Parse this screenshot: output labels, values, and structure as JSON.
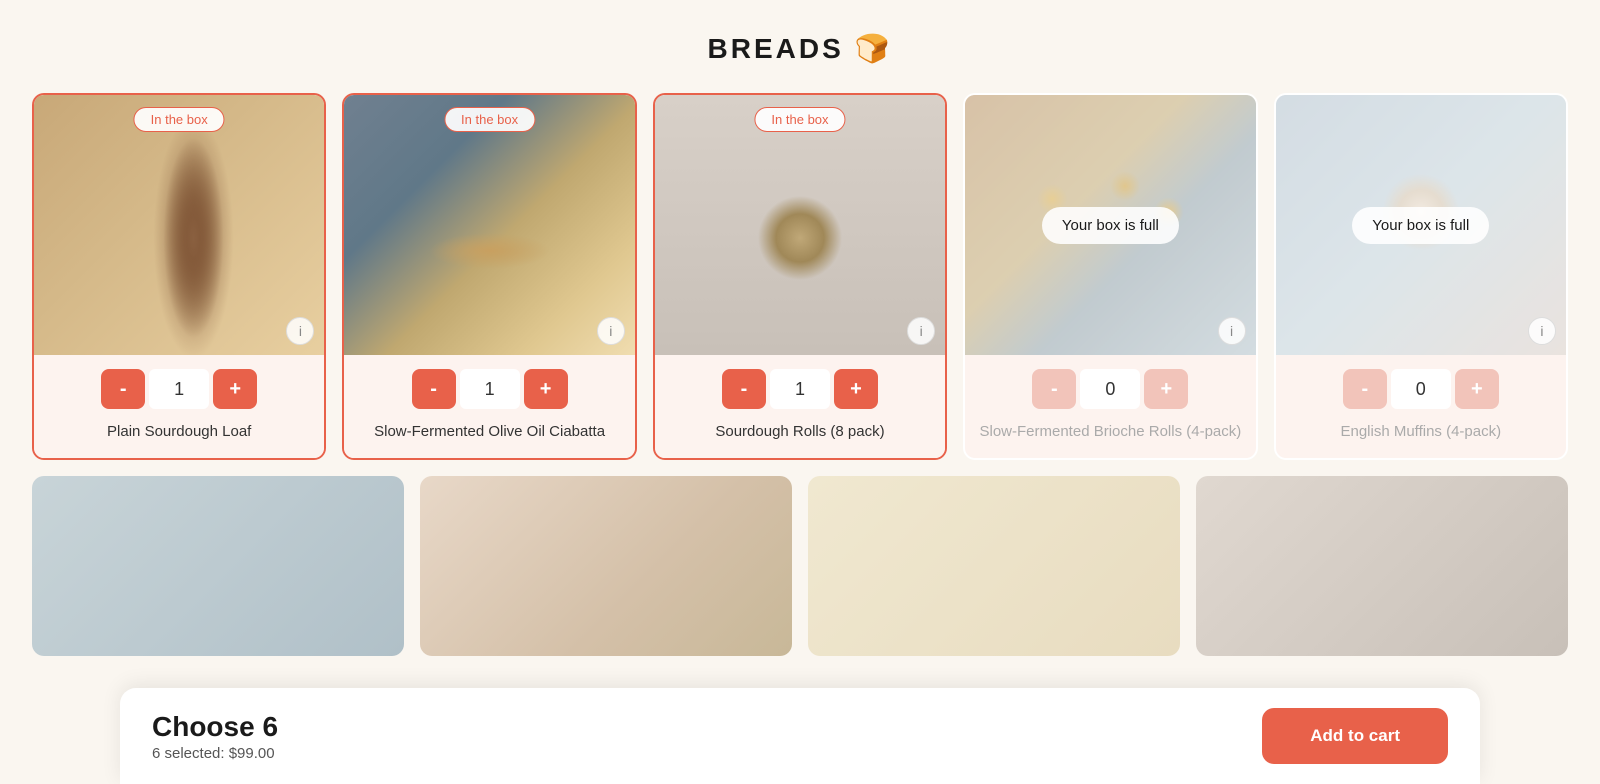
{
  "page": {
    "title": "BREADS",
    "title_emoji": "🍞"
  },
  "products": [
    {
      "id": "plain-sourdough",
      "name": "Plain Sourdough Loaf",
      "in_box": true,
      "box_full": false,
      "quantity": 1,
      "img_class": "loaf-bg"
    },
    {
      "id": "ciabatta",
      "name": "Slow-Fermented Olive Oil Ciabatta",
      "in_box": true,
      "box_full": false,
      "quantity": 1,
      "img_class": "ciabatta-bg"
    },
    {
      "id": "sourdough-rolls",
      "name": "Sourdough Rolls (8 pack)",
      "in_box": true,
      "box_full": false,
      "quantity": 1,
      "img_class": "rolls-bg"
    },
    {
      "id": "brioche-rolls",
      "name": "Slow-Fermented Brioche Rolls (4-pack)",
      "in_box": false,
      "box_full": true,
      "quantity": 0,
      "img_class": "brioche-bg"
    },
    {
      "id": "english-muffins",
      "name": "English Muffins (4-pack)",
      "in_box": false,
      "box_full": true,
      "quantity": 0,
      "img_class": "muffins-bg"
    }
  ],
  "badges": {
    "in_box": "In the box",
    "box_full": "Your box is full"
  },
  "controls": {
    "minus": "-",
    "plus": "+"
  },
  "bottom_bar": {
    "choose_label": "Choose 6",
    "selected_text": "6 selected: $99.00",
    "add_to_cart": "Add to cart"
  }
}
